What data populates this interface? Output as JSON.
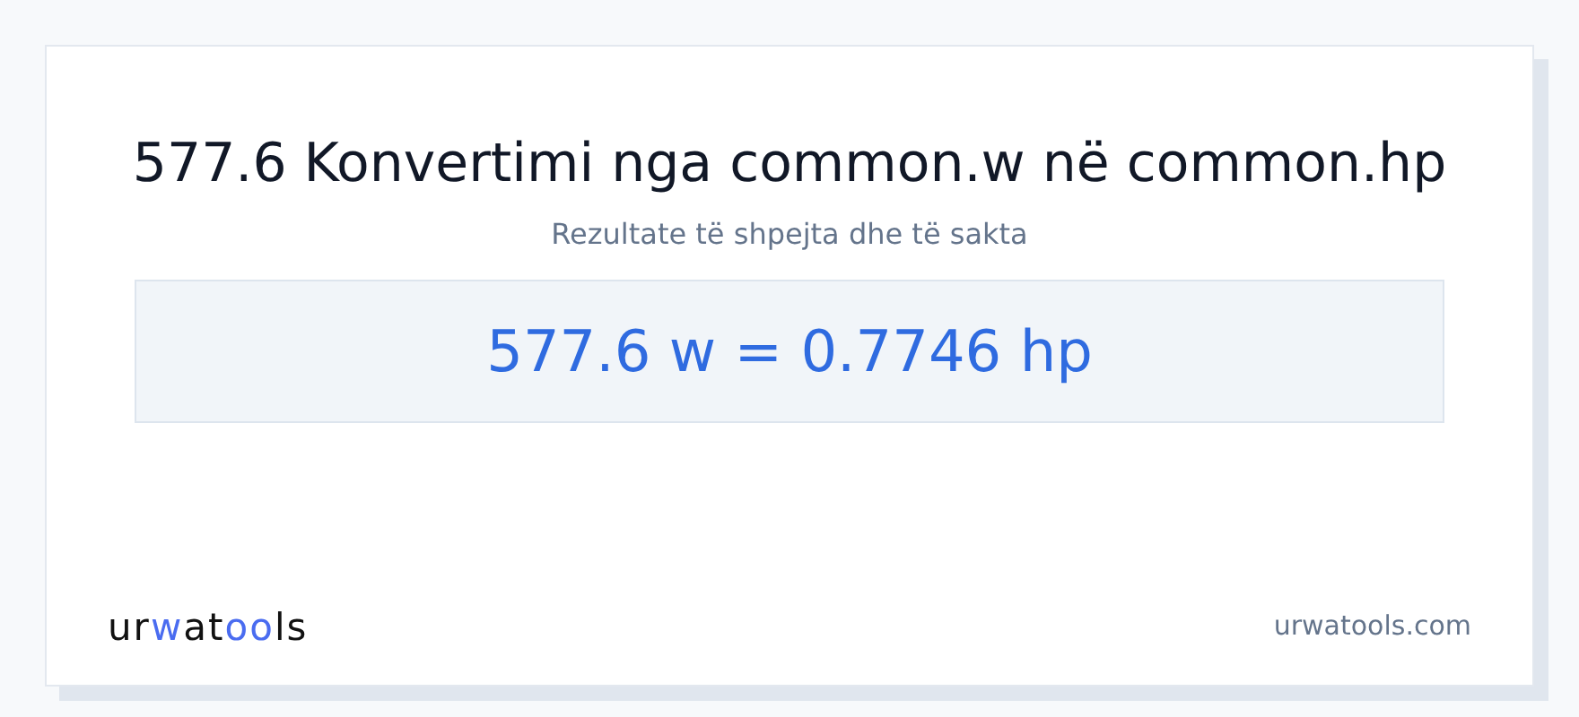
{
  "title": "577.6 Konvertimi nga common.w në common.hp",
  "subtitle": "Rezultate të shpejta dhe të sakta",
  "result": "577.6 w = 0.7746 hp",
  "logo": [
    {
      "text": "ur",
      "accent": false
    },
    {
      "text": "w",
      "accent": true
    },
    {
      "text": "at",
      "accent": false
    },
    {
      "text": "oo",
      "accent": true
    },
    {
      "text": "ls",
      "accent": false
    }
  ],
  "site": "urwatools.com"
}
